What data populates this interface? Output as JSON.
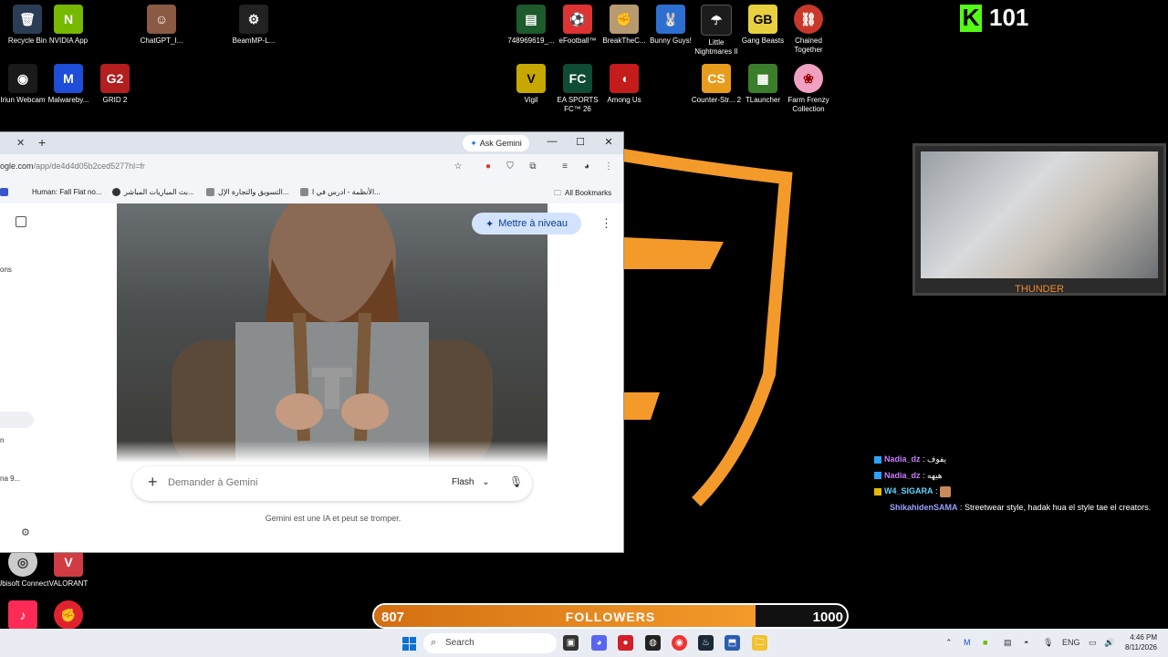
{
  "desktop": {
    "icons": [
      {
        "label": "Recycle Bin",
        "glyph": "🗑",
        "bg": "#2a3d55"
      },
      {
        "label": "NVIDIA App",
        "glyph": "N",
        "bg": "#76b900"
      },
      {
        "label": "ChatGPT_I...",
        "glyph": "☺",
        "bg": "#8a5a44"
      },
      {
        "label": "BeamMP-L...",
        "glyph": "⚙",
        "bg": "#222"
      },
      {
        "label": "748969619_...",
        "glyph": "▤",
        "bg": "#1d5a2c"
      },
      {
        "label": "eFootball™",
        "glyph": "⚽",
        "bg": "#d33"
      },
      {
        "label": "BreakTheC...",
        "glyph": "✊",
        "bg": "#b89a70"
      },
      {
        "label": "Bunny Guys!",
        "glyph": "🐰",
        "bg": "#2c6fd0"
      },
      {
        "label": "Little Nightmares II",
        "glyph": "☂",
        "bg": "#1c1c1c"
      },
      {
        "label": "Gang Beasts",
        "glyph": "GB",
        "bg": "#e8d040"
      },
      {
        "label": "Chained Together",
        "glyph": "⛓",
        "bg": "#c8382a"
      },
      {
        "label": "Iriun Webcam",
        "glyph": "◉",
        "bg": "#1a1a1a"
      },
      {
        "label": "Malwareby...",
        "glyph": "M",
        "bg": "#1e4dd8"
      },
      {
        "label": "GRID 2",
        "glyph": "G2",
        "bg": "#b31e1e"
      },
      {
        "label": "Vigil",
        "glyph": "V",
        "bg": "#c6a800"
      },
      {
        "label": "EA SPORTS FC™ 26",
        "glyph": "FC",
        "bg": "#0e4c33"
      },
      {
        "label": "Among Us",
        "glyph": "◖",
        "bg": "#c41b1b"
      },
      {
        "label": "Counter-Str... 2",
        "glyph": "CS",
        "bg": "#e89c1c"
      },
      {
        "label": "TLauncher",
        "glyph": "▦",
        "bg": "#3a7d2a"
      },
      {
        "label": "Farm Frenzy Collection",
        "glyph": "❀",
        "bg": "#f0a0c0"
      },
      {
        "label": "Ubisoft Connect",
        "glyph": "◎",
        "bg": "#cccccc"
      },
      {
        "label": "VALORANT",
        "glyph": "V",
        "bg": "#d13b44"
      }
    ]
  },
  "kick": {
    "count": "101"
  },
  "browser": {
    "ask_gemini": "Ask Gemini",
    "url_host": "ogle.com",
    "url_path": "/app/de4d4d05b2ced5277hl=fr",
    "bookmarks": [
      "Human: Fall Flat no...",
      "بث المباريات المباشر...",
      "التسويق والتجارة الإل...",
      "الأنظمة - ادرس في ا..."
    ],
    "all_bookmarks": "All Bookmarks",
    "sidebar_texts": [
      "ons",
      "n",
      "na 9..."
    ],
    "upgrade": "Mettre à niveau",
    "prompt_placeholder": "Demander à Gemini",
    "model": "Flash",
    "disclaimer": "Gemini est une IA et peut se tromper."
  },
  "webcam": {
    "name": "THUNDER"
  },
  "chat": [
    {
      "user": "Nadia_dz",
      "message": "يفوف"
    },
    {
      "user": "Nadia_dz",
      "message": "هيهه"
    },
    {
      "user": "W4_SIGARA",
      "message": ""
    },
    {
      "user": "ShikahidenSAMA",
      "message": "Streetwear style, hadak hua el style tae el creators."
    }
  ],
  "followers": {
    "current": "807",
    "label": "FOLLOWERS",
    "goal": "1000",
    "progress": 0.807
  },
  "taskbar": {
    "search": "Search",
    "lang": "ENG",
    "time": "4:46 PM",
    "date": "8/11/2026"
  },
  "colors": {
    "accent": "#f39a2a",
    "kick_green": "#53fc18"
  }
}
